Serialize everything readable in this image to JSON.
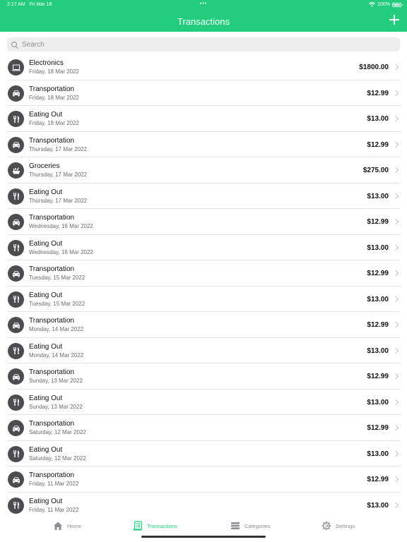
{
  "status_bar": {
    "time": "2:17 AM",
    "date": "Fri Mar 18",
    "dots": "•••",
    "battery": "100%"
  },
  "header": {
    "title": "Transactions",
    "add_icon": "plus-icon"
  },
  "search": {
    "placeholder": "Search",
    "value": ""
  },
  "colors": {
    "accent": "#24cc7e",
    "icon_bg": "#4d4d4f"
  },
  "transactions": [
    {
      "category": "Electronics",
      "icon": "laptop-icon",
      "date": "Friday, 18 Mar 2022",
      "amount": "$1800.00"
    },
    {
      "category": "Transportation",
      "icon": "car-icon",
      "date": "Friday, 18 Mar 2022",
      "amount": "$12.99"
    },
    {
      "category": "Eating Out",
      "icon": "fork-knife-icon",
      "date": "Friday, 18 Mar 2022",
      "amount": "$13.00"
    },
    {
      "category": "Transportation",
      "icon": "car-icon",
      "date": "Thursday, 17 Mar 2022",
      "amount": "$12.99"
    },
    {
      "category": "Groceries",
      "icon": "grocery-basket-icon",
      "date": "Thursday, 17 Mar 2022",
      "amount": "$275.00"
    },
    {
      "category": "Eating Out",
      "icon": "fork-knife-icon",
      "date": "Thursday, 17 Mar 2022",
      "amount": "$13.00"
    },
    {
      "category": "Transportation",
      "icon": "car-icon",
      "date": "Wednesday, 16 Mar 2022",
      "amount": "$12.99"
    },
    {
      "category": "Eating Out",
      "icon": "fork-knife-icon",
      "date": "Wednesday, 16 Mar 2022",
      "amount": "$13.00"
    },
    {
      "category": "Transportation",
      "icon": "car-icon",
      "date": "Tuesday, 15 Mar 2022",
      "amount": "$12.99"
    },
    {
      "category": "Eating Out",
      "icon": "fork-knife-icon",
      "date": "Tuesday, 15 Mar 2022",
      "amount": "$13.00"
    },
    {
      "category": "Transportation",
      "icon": "car-icon",
      "date": "Monday, 14 Mar 2022",
      "amount": "$12.99"
    },
    {
      "category": "Eating Out",
      "icon": "fork-knife-icon",
      "date": "Monday, 14 Mar 2022",
      "amount": "$13.00"
    },
    {
      "category": "Transportation",
      "icon": "car-icon",
      "date": "Sunday, 13 Mar 2022",
      "amount": "$12.99"
    },
    {
      "category": "Eating Out",
      "icon": "fork-knife-icon",
      "date": "Sunday, 13 Mar 2022",
      "amount": "$13.00"
    },
    {
      "category": "Transportation",
      "icon": "car-icon",
      "date": "Saturday, 12 Mar 2022",
      "amount": "$12.99"
    },
    {
      "category": "Eating Out",
      "icon": "fork-knife-icon",
      "date": "Saturday, 12 Mar 2022",
      "amount": "$13.00"
    },
    {
      "category": "Transportation",
      "icon": "car-icon",
      "date": "Friday, 11 Mar 2022",
      "amount": "$12.99"
    },
    {
      "category": "Eating Out",
      "icon": "fork-knife-icon",
      "date": "Friday, 11 Mar 2022",
      "amount": "$13.00"
    }
  ],
  "tabbar": {
    "tabs": [
      {
        "label": "Home",
        "icon": "house-icon",
        "active": false
      },
      {
        "label": "Transactions",
        "icon": "receipt-icon",
        "active": true
      },
      {
        "label": "Categories",
        "icon": "stack-icon",
        "active": false
      },
      {
        "label": "Settings",
        "icon": "gear-icon",
        "active": false
      }
    ]
  }
}
